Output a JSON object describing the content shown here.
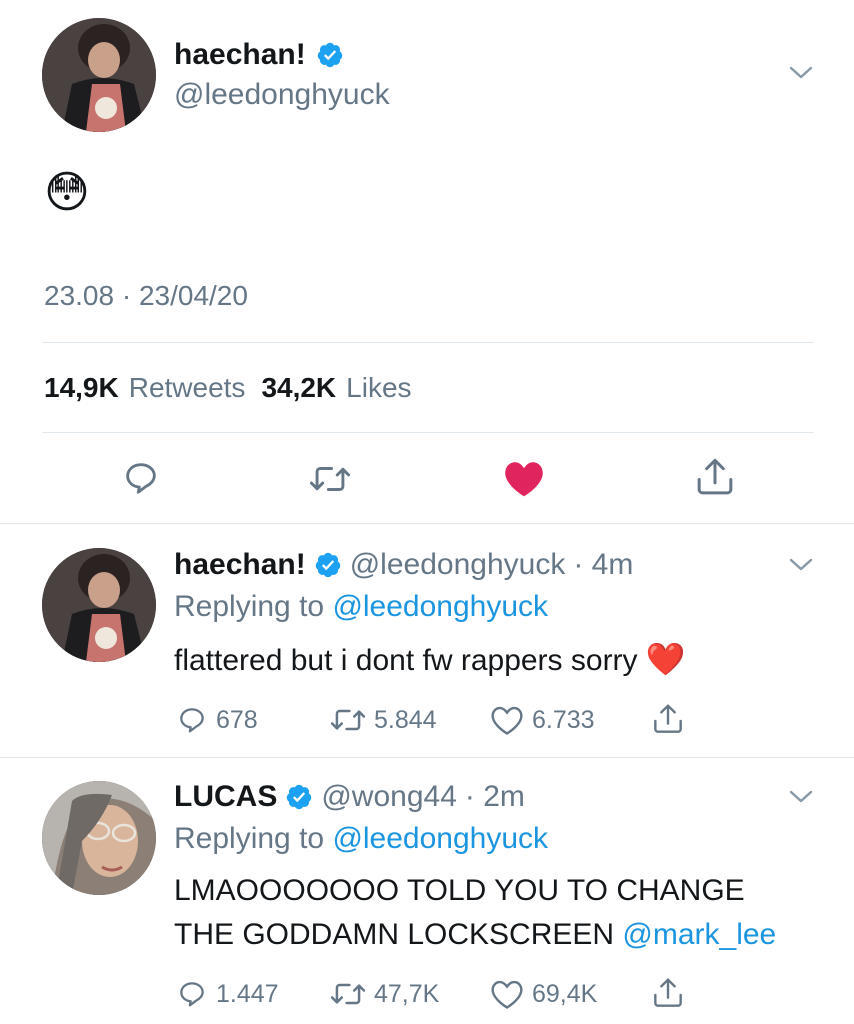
{
  "main_tweet": {
    "display_name": "haechan!",
    "handle": "@leedonghyuck",
    "emoji": "😳",
    "timestamp": "23.08 · 23/04/20",
    "retweets_count": "14,9K",
    "retweets_label": "Retweets",
    "likes_count": "34,2K",
    "likes_label": "Likes",
    "liked": true
  },
  "replies": [
    {
      "display_name": "haechan!",
      "handle": "@leedonghyuck",
      "time": "· 4m",
      "replying_label": "Replying to",
      "replying_to": "@leedonghyuck",
      "text": "flattered but i dont fw rappers sorry",
      "trailing_emoji": "❤️",
      "mention": "",
      "reply_count": "678",
      "retweet_count": "5.844",
      "like_count": "6.733"
    },
    {
      "display_name": "LUCAS",
      "handle": "@wong44",
      "time": "· 2m",
      "replying_label": "Replying to",
      "replying_to": "@leedonghyuck",
      "text_line1": "LMAOOOOOOO TOLD YOU TO CHANGE",
      "text_line2": "THE GODDAMN LOCKSCREEN",
      "mention": "@mark_lee",
      "reply_count": "1.447",
      "retweet_count": "47,7K",
      "like_count": "69,4K"
    }
  ],
  "colors": {
    "like_red": "#e0245e",
    "link_blue": "#1b95e0",
    "verified_blue": "#1da1f2",
    "gray": "#657786",
    "divider": "#e1e8ed"
  },
  "icons": [
    "verified-badge-icon",
    "chevron-down-icon",
    "reply-icon",
    "retweet-icon",
    "heart-icon",
    "share-icon"
  ]
}
